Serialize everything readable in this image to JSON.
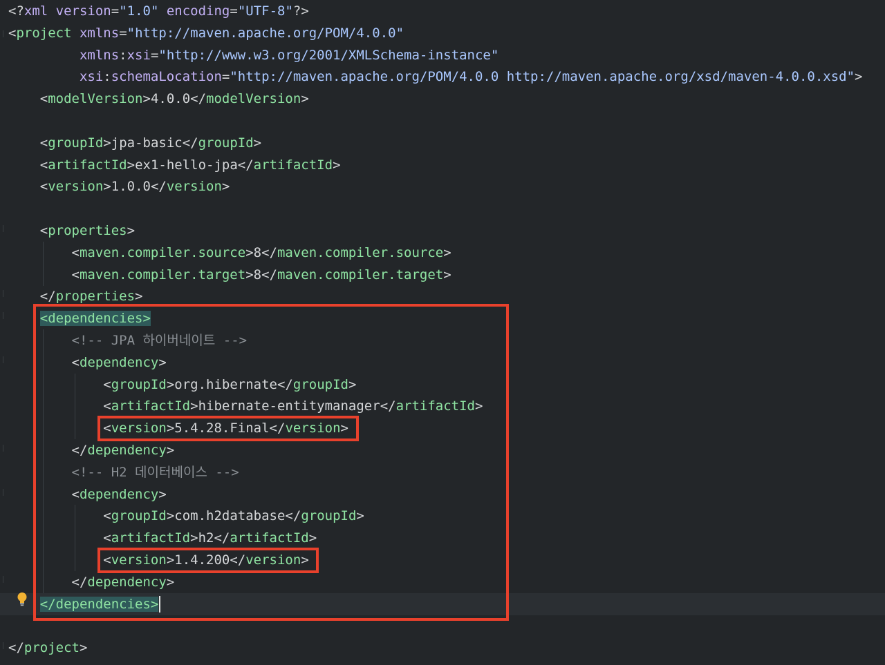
{
  "editor": {
    "lines": [
      [
        [
          "pi",
          "<?"
        ],
        [
          "attr",
          "xml"
        ],
        [
          "text",
          " "
        ],
        [
          "attr",
          "version"
        ],
        [
          "br",
          "="
        ],
        [
          "val",
          "\"1.0\""
        ],
        [
          "text",
          " "
        ],
        [
          "attr",
          "encoding"
        ],
        [
          "br",
          "="
        ],
        [
          "val",
          "\"UTF-8\""
        ],
        [
          "pi",
          "?>"
        ]
      ],
      [
        [
          "br",
          "<"
        ],
        [
          "tag",
          "project"
        ],
        [
          "text",
          " "
        ],
        [
          "attr",
          "xmlns"
        ],
        [
          "br",
          "="
        ],
        [
          "val",
          "\"http://maven.apache.org/POM/4.0.0\""
        ]
      ],
      [
        [
          "text",
          "         "
        ],
        [
          "attr",
          "xmlns"
        ],
        [
          "br",
          ":"
        ],
        [
          "ns",
          "xsi"
        ],
        [
          "br",
          "="
        ],
        [
          "val",
          "\"http://www.w3.org/2001/XMLSchema-instance\""
        ]
      ],
      [
        [
          "text",
          "         "
        ],
        [
          "ns",
          "xsi"
        ],
        [
          "br",
          ":"
        ],
        [
          "attr",
          "schemaLocation"
        ],
        [
          "br",
          "="
        ],
        [
          "val",
          "\"http://maven.apache.org/POM/4.0.0 http://maven.apache.org/xsd/maven-4.0.0.xsd\""
        ],
        [
          "br",
          ">"
        ]
      ],
      [
        [
          "text",
          "    "
        ],
        [
          "br",
          "<"
        ],
        [
          "tag",
          "modelVersion"
        ],
        [
          "br",
          ">"
        ],
        [
          "text",
          "4.0.0"
        ],
        [
          "br",
          "</"
        ],
        [
          "tag",
          "modelVersion"
        ],
        [
          "br",
          ">"
        ]
      ],
      [],
      [
        [
          "text",
          "    "
        ],
        [
          "br",
          "<"
        ],
        [
          "tag",
          "groupId"
        ],
        [
          "br",
          ">"
        ],
        [
          "text",
          "jpa-basic"
        ],
        [
          "br",
          "</"
        ],
        [
          "tag",
          "groupId"
        ],
        [
          "br",
          ">"
        ]
      ],
      [
        [
          "text",
          "    "
        ],
        [
          "br",
          "<"
        ],
        [
          "tag",
          "artifactId"
        ],
        [
          "br",
          ">"
        ],
        [
          "text",
          "ex1-hello-jpa"
        ],
        [
          "br",
          "</"
        ],
        [
          "tag",
          "artifactId"
        ],
        [
          "br",
          ">"
        ]
      ],
      [
        [
          "text",
          "    "
        ],
        [
          "br",
          "<"
        ],
        [
          "tag",
          "version"
        ],
        [
          "br",
          ">"
        ],
        [
          "text",
          "1.0.0"
        ],
        [
          "br",
          "</"
        ],
        [
          "tag",
          "version"
        ],
        [
          "br",
          ">"
        ]
      ],
      [],
      [
        [
          "text",
          "    "
        ],
        [
          "br",
          "<"
        ],
        [
          "tag",
          "properties"
        ],
        [
          "br",
          ">"
        ]
      ],
      [
        [
          "text",
          "        "
        ],
        [
          "br",
          "<"
        ],
        [
          "tag",
          "maven.compiler.source"
        ],
        [
          "br",
          ">"
        ],
        [
          "text",
          "8"
        ],
        [
          "br",
          "</"
        ],
        [
          "tag",
          "maven.compiler.source"
        ],
        [
          "br",
          ">"
        ]
      ],
      [
        [
          "text",
          "        "
        ],
        [
          "br",
          "<"
        ],
        [
          "tag",
          "maven.compiler.target"
        ],
        [
          "br",
          ">"
        ],
        [
          "text",
          "8"
        ],
        [
          "br",
          "</"
        ],
        [
          "tag",
          "maven.compiler.target"
        ],
        [
          "br",
          ">"
        ]
      ],
      [
        [
          "text",
          "    "
        ],
        [
          "br",
          "</"
        ],
        [
          "tag",
          "properties"
        ],
        [
          "br",
          ">"
        ]
      ],
      [
        [
          "text",
          "    "
        ],
        [
          "hlopen",
          "<dependencies>"
        ]
      ],
      [
        [
          "text",
          "        "
        ],
        [
          "comment",
          "<!-- JPA 하이버네이트 -->"
        ]
      ],
      [
        [
          "text",
          "        "
        ],
        [
          "br",
          "<"
        ],
        [
          "tag",
          "dependency"
        ],
        [
          "br",
          ">"
        ]
      ],
      [
        [
          "text",
          "            "
        ],
        [
          "br",
          "<"
        ],
        [
          "tag",
          "groupId"
        ],
        [
          "br",
          ">"
        ],
        [
          "text",
          "org.hibernate"
        ],
        [
          "br",
          "</"
        ],
        [
          "tag",
          "groupId"
        ],
        [
          "br",
          ">"
        ]
      ],
      [
        [
          "text",
          "            "
        ],
        [
          "br",
          "<"
        ],
        [
          "tag",
          "artifactId"
        ],
        [
          "br",
          ">"
        ],
        [
          "text",
          "hibernate-entitymanager"
        ],
        [
          "br",
          "</"
        ],
        [
          "tag",
          "artifactId"
        ],
        [
          "br",
          ">"
        ]
      ],
      [
        [
          "text",
          "            "
        ],
        [
          "br",
          "<"
        ],
        [
          "tag",
          "version"
        ],
        [
          "br",
          ">"
        ],
        [
          "text",
          "5.4.28.Final"
        ],
        [
          "br",
          "</"
        ],
        [
          "tag",
          "version"
        ],
        [
          "br",
          ">"
        ]
      ],
      [
        [
          "text",
          "        "
        ],
        [
          "br",
          "</"
        ],
        [
          "tag",
          "dependency"
        ],
        [
          "br",
          ">"
        ]
      ],
      [
        [
          "text",
          "        "
        ],
        [
          "comment",
          "<!-- H2 데이터베이스 -->"
        ]
      ],
      [
        [
          "text",
          "        "
        ],
        [
          "br",
          "<"
        ],
        [
          "tag",
          "dependency"
        ],
        [
          "br",
          ">"
        ]
      ],
      [
        [
          "text",
          "            "
        ],
        [
          "br",
          "<"
        ],
        [
          "tag",
          "groupId"
        ],
        [
          "br",
          ">"
        ],
        [
          "text",
          "com.h2database"
        ],
        [
          "br",
          "</"
        ],
        [
          "tag",
          "groupId"
        ],
        [
          "br",
          ">"
        ]
      ],
      [
        [
          "text",
          "            "
        ],
        [
          "br",
          "<"
        ],
        [
          "tag",
          "artifactId"
        ],
        [
          "br",
          ">"
        ],
        [
          "text",
          "h2"
        ],
        [
          "br",
          "</"
        ],
        [
          "tag",
          "artifactId"
        ],
        [
          "br",
          ">"
        ]
      ],
      [
        [
          "text",
          "            "
        ],
        [
          "br",
          "<"
        ],
        [
          "tag",
          "version"
        ],
        [
          "br",
          ">"
        ],
        [
          "text",
          "1.4.200"
        ],
        [
          "br",
          "</"
        ],
        [
          "tag",
          "version"
        ],
        [
          "br",
          ">"
        ]
      ],
      [
        [
          "text",
          "        "
        ],
        [
          "br",
          "</"
        ],
        [
          "tag",
          "dependency"
        ],
        [
          "br",
          ">"
        ]
      ],
      [
        [
          "text",
          "    "
        ],
        [
          "hlclose",
          "</dependencies>"
        ]
      ],
      [],
      [
        [
          "br",
          "</"
        ],
        [
          "tag",
          "project"
        ],
        [
          "br",
          ">"
        ]
      ]
    ]
  },
  "highlight_color": "#e8412c",
  "current_line_index": 27,
  "icons": {
    "intention": "lightbulb-icon"
  }
}
